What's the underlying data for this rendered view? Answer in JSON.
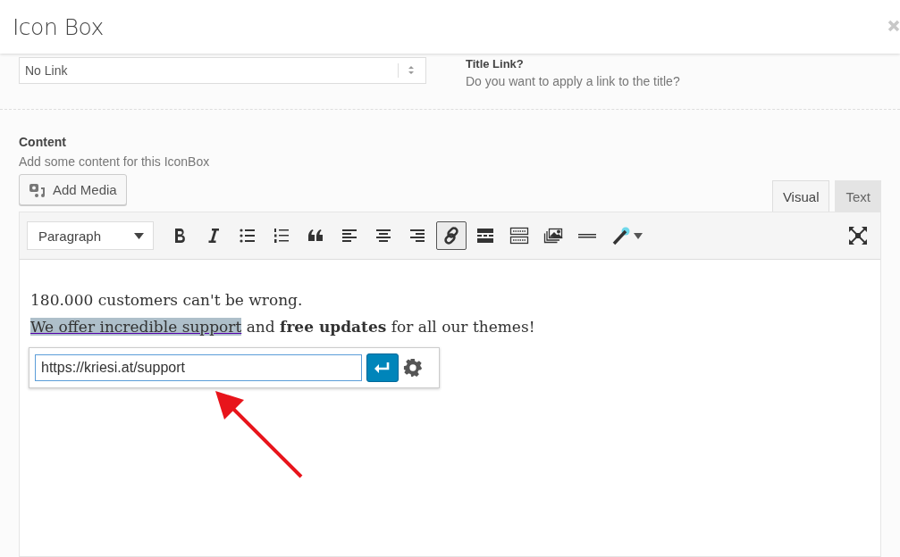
{
  "window": {
    "title": "Icon Box"
  },
  "title_link": {
    "select_value": "No Link",
    "label": "Title Link?",
    "description": "Do you want to apply a link to the title?"
  },
  "content": {
    "label": "Content",
    "description": "Add some content for this IconBox"
  },
  "add_media": {
    "label": "Add Media"
  },
  "tabs": [
    {
      "label": "Visual",
      "selected": true
    },
    {
      "label": "Text",
      "selected": false
    }
  ],
  "toolbar": {
    "format": "Paragraph",
    "buttons": [
      {
        "kind": "bold",
        "active": false
      },
      {
        "kind": "italic",
        "active": false
      },
      {
        "kind": "bullets",
        "active": false
      },
      {
        "kind": "numbers",
        "active": false
      },
      {
        "kind": "quote",
        "active": false
      },
      {
        "kind": "align-left",
        "active": false
      },
      {
        "kind": "align-center",
        "active": false
      },
      {
        "kind": "align-right",
        "active": false
      },
      {
        "kind": "link",
        "active": true
      },
      {
        "kind": "more",
        "active": false
      },
      {
        "kind": "keyboard",
        "active": false
      },
      {
        "kind": "gallery",
        "active": false
      },
      {
        "kind": "rule",
        "active": false
      },
      {
        "kind": "wand",
        "active": false
      }
    ]
  },
  "paragraphs": [
    {
      "segments": [
        {
          "kind": "plain",
          "text": "180.000 customers can't be wrong.",
          "highlighted": false
        }
      ]
    },
    {
      "segments": [
        {
          "kind": "link",
          "text": "We offer incredible support",
          "highlighted": true
        },
        {
          "kind": "plain",
          "text": " and ",
          "highlighted": false
        },
        {
          "kind": "bold",
          "text": "free updates",
          "highlighted": false
        },
        {
          "kind": "plain",
          "text": " for all our themes!",
          "highlighted": false
        }
      ]
    }
  ],
  "link_popup": {
    "url": "https://kriesi.at/support"
  }
}
